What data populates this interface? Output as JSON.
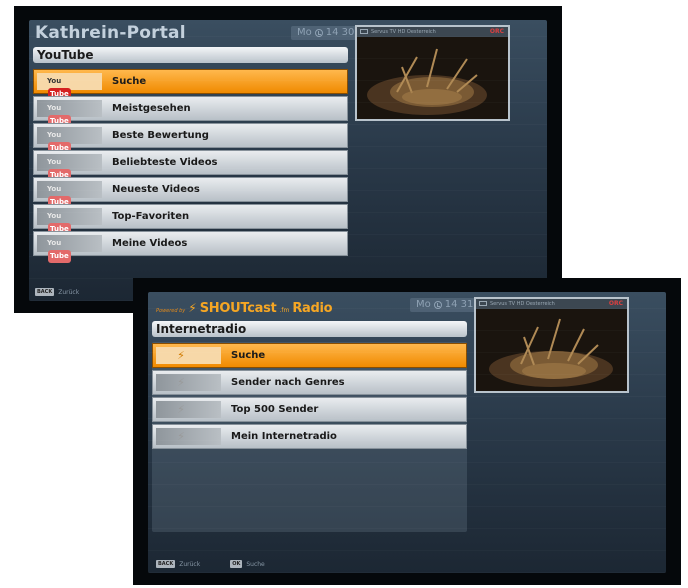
{
  "screen1": {
    "title": "Kathrein-Portal",
    "clock_day": "Mo",
    "clock_time": "14 30",
    "section": "YouTube",
    "thumb_icon_text": "You",
    "thumb_icon_tube": "Tube",
    "menu": [
      "Suche",
      "Meistgesehen",
      "Beste Bewertung",
      "Beliebteste Videos",
      "Neueste Videos",
      "Top-Favoriten",
      "Meine Videos"
    ],
    "selected_index": 0,
    "preview_channel": "Servus TV HD Oesterreich",
    "preview_badge": "ORC",
    "footer": [
      {
        "key": "BACK",
        "label": "Zurück"
      }
    ]
  },
  "screen2": {
    "logo_powered": "Powered by",
    "logo_name": "SHOUTcast",
    "logo_suffix": "Radio",
    "clock_day": "Mo",
    "clock_time": "14 31",
    "section": "Internetradio",
    "menu": [
      "Suche",
      "Sender nach Genres",
      "Top 500 Sender",
      "Mein Internetradio"
    ],
    "selected_index": 0,
    "preview_channel": "Servus TV HD Oesterreich",
    "preview_badge": "ORC",
    "footer": [
      {
        "key": "BACK",
        "label": "Zurück"
      },
      {
        "key": "OK",
        "label": "Suche"
      }
    ]
  },
  "colors": {
    "accent": "#f08a00",
    "panel": "#2a3a4a",
    "frame": "#05080b"
  }
}
